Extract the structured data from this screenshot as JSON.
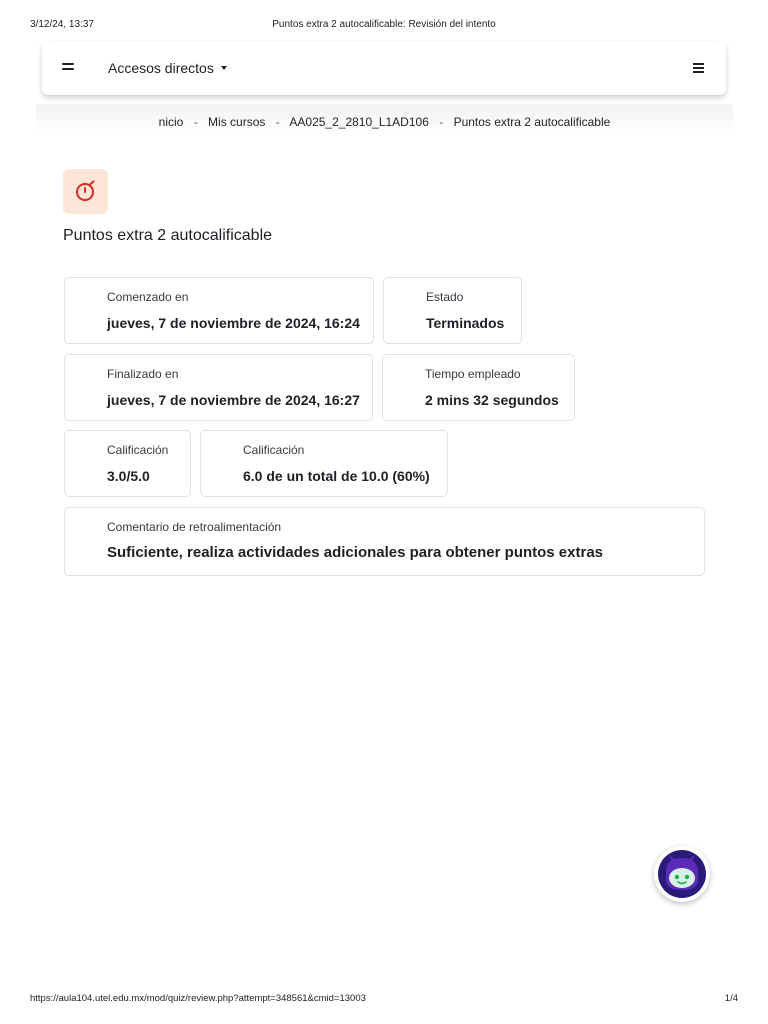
{
  "print_header": {
    "datetime": "3/12/24, 13:37",
    "title": "Puntos extra 2 autocalificable: Revisión del intento"
  },
  "navbar": {
    "shortcuts_label": "Accesos directos"
  },
  "breadcrumb": {
    "separator": "-",
    "items": [
      "nicio",
      "Mis cursos",
      "AA025_2_2810_L1AD106",
      "Puntos extra 2 autocalificable"
    ]
  },
  "activity": {
    "icon": "stopwatch-icon",
    "icon_color": "#e0261f",
    "icon_bg": "#fbe6d9",
    "title": "Puntos extra 2 autocalificable"
  },
  "summary": {
    "started": {
      "label": "Comenzado en",
      "value": "jueves, 7 de noviembre de 2024, 16:24"
    },
    "state": {
      "label": "Estado",
      "value": "Terminados"
    },
    "finished": {
      "label": "Finalizado en",
      "value": "jueves, 7 de noviembre de 2024, 16:27"
    },
    "time_taken": {
      "label": "Tiempo empleado",
      "value": "2 mins 32 segundos"
    },
    "marks": {
      "label": "Calificación",
      "value": "3.0/5.0"
    },
    "grade": {
      "label": "Calificación",
      "value": "6.0 de un total de 10.0 (60%)"
    },
    "feedback": {
      "label": "Comentario de retroalimentación",
      "value": "Suficiente, realiza actividades adicionales para obtener puntos extras"
    }
  },
  "chat_widget": {
    "icon": "chatbot-avatar-icon"
  },
  "print_footer": {
    "url": "https://aula104.utel.edu.mx/mod/quiz/review.php?attempt=348561&cmid=13003",
    "page": "1/4"
  }
}
